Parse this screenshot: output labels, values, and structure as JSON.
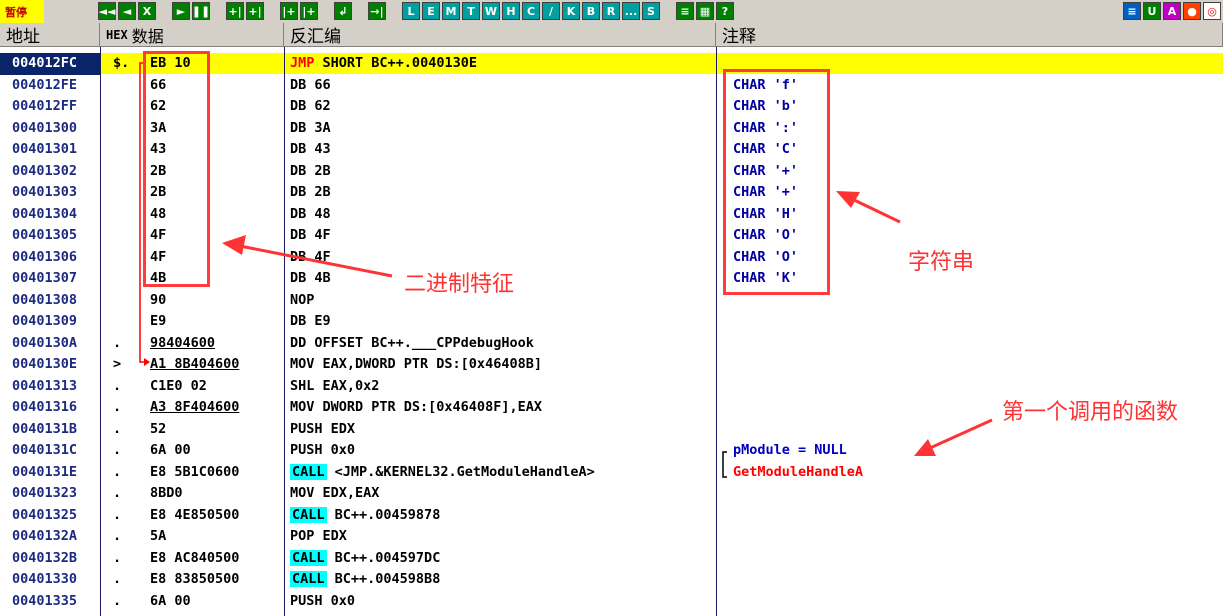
{
  "toolbar": {
    "status": "暂停",
    "buttons": [
      "◄◄",
      "◄",
      "X",
      "►",
      "❚❚",
      "+|",
      "+|",
      "|+",
      "|+",
      "↲",
      "→|",
      "L",
      "E",
      "M",
      "T",
      "W",
      "H",
      "C",
      "/",
      "K",
      "B",
      "R",
      "...",
      "S",
      "≡",
      "▦",
      "?"
    ],
    "right_buttons": [
      "≡",
      "U",
      "A",
      "●",
      "◎"
    ]
  },
  "columns": {
    "address": "地址",
    "hex_prefix": "HEX",
    "hex": "数据",
    "disasm": "反汇编",
    "comment": "注释"
  },
  "rows": [
    {
      "addr": "004012FC",
      "mark": "$.",
      "hex": "EB 10",
      "dis": "SHORT BC++.0040130E",
      "dis_kw": "JMP"
    },
    {
      "addr": "004012FE",
      "mark": "",
      "hex": "66",
      "dis": "DB 66",
      "cmt": "CHAR 'f'"
    },
    {
      "addr": "004012FF",
      "mark": "",
      "hex": "62",
      "dis": "DB 62",
      "cmt": "CHAR 'b'"
    },
    {
      "addr": "00401300",
      "mark": "",
      "hex": "3A",
      "dis": "DB 3A",
      "cmt": "CHAR ':'"
    },
    {
      "addr": "00401301",
      "mark": "",
      "hex": "43",
      "dis": "DB 43",
      "cmt": "CHAR 'C'"
    },
    {
      "addr": "00401302",
      "mark": "",
      "hex": "2B",
      "dis": "DB 2B",
      "cmt": "CHAR '+'"
    },
    {
      "addr": "00401303",
      "mark": "",
      "hex": "2B",
      "dis": "DB 2B",
      "cmt": "CHAR '+'"
    },
    {
      "addr": "00401304",
      "mark": "",
      "hex": "48",
      "dis": "DB 48",
      "cmt": "CHAR 'H'"
    },
    {
      "addr": "00401305",
      "mark": "",
      "hex": "4F",
      "dis": "DB 4F",
      "cmt": "CHAR 'O'"
    },
    {
      "addr": "00401306",
      "mark": "",
      "hex": "4F",
      "dis": "DB 4F",
      "cmt": "CHAR 'O'"
    },
    {
      "addr": "00401307",
      "mark": "",
      "hex": "4B",
      "dis": "DB 4B",
      "cmt": "CHAR 'K'"
    },
    {
      "addr": "00401308",
      "mark": "",
      "hex": "90",
      "dis": "NOP"
    },
    {
      "addr": "00401309",
      "mark": "",
      "hex": "E9",
      "dis": "DB E9"
    },
    {
      "addr": "0040130A",
      "mark": ".",
      "hex": "98404600",
      "dis": "DD OFFSET BC++.___CPPdebugHook"
    },
    {
      "addr": "0040130E",
      "mark": ">",
      "hex": "A1 8B404600",
      "dis": "MOV EAX,DWORD PTR DS:[0x46408B]"
    },
    {
      "addr": "00401313",
      "mark": ".",
      "hex": "C1E0 02",
      "dis": "SHL EAX,0x2"
    },
    {
      "addr": "00401316",
      "mark": ".",
      "hex": "A3 8F404600",
      "dis": "MOV DWORD PTR DS:[0x46408F],EAX"
    },
    {
      "addr": "0040131B",
      "mark": ".",
      "hex": "52",
      "dis": "PUSH EDX"
    },
    {
      "addr": "0040131C",
      "mark": ".",
      "hex": "6A 00",
      "dis": "PUSH 0x0",
      "cmt": "pModule = NULL"
    },
    {
      "addr": "0040131E",
      "mark": ".",
      "hex": "E8 5B1C0600",
      "dis": "<JMP.&KERNEL32.GetModuleHandleA>",
      "dis_kw": "CALL",
      "cmt": "GetModuleHandleA"
    },
    {
      "addr": "00401323",
      "mark": ".",
      "hex": "8BD0",
      "dis": "MOV EDX,EAX"
    },
    {
      "addr": "00401325",
      "mark": ".",
      "hex": "E8 4E850500",
      "dis": "BC++.00459878",
      "dis_kw": "CALL"
    },
    {
      "addr": "0040132A",
      "mark": ".",
      "hex": "5A",
      "dis": "POP EDX"
    },
    {
      "addr": "0040132B",
      "mark": ".",
      "hex": "E8 AC840500",
      "dis": "BC++.004597DC",
      "dis_kw": "CALL"
    },
    {
      "addr": "00401330",
      "mark": ".",
      "hex": "E8 83850500",
      "dis": "BC++.004598B8",
      "dis_kw": "CALL"
    },
    {
      "addr": "00401335",
      "mark": ".",
      "hex": "6A 00",
      "dis": "PUSH 0x0"
    }
  ],
  "annotations": {
    "binary_features": "二进制特征",
    "strings": "字符串",
    "first_called_function": "第一个调用的函数"
  },
  "colors": {
    "selected_row": "#ffff00",
    "address_selected": "#0a246a",
    "call_highlight": "#00ffff",
    "annotation": "#ff3333"
  }
}
